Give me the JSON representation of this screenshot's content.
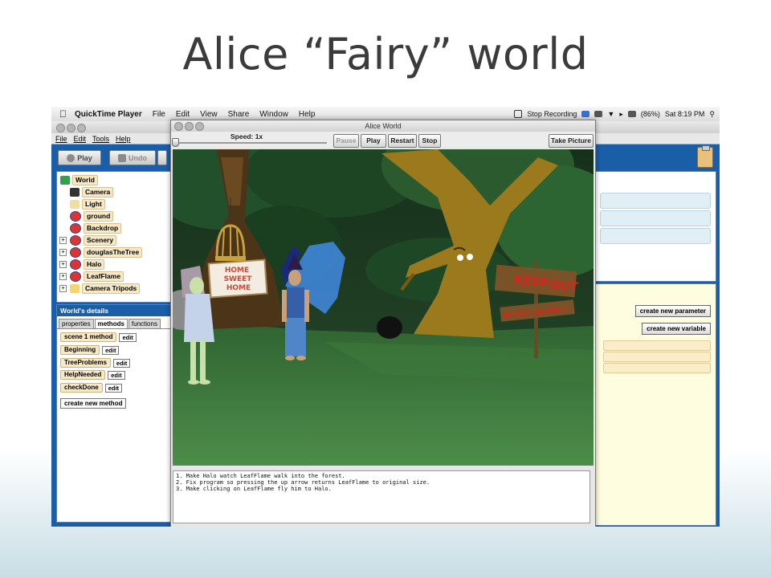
{
  "slide": {
    "title": "Alice “Fairy” world"
  },
  "mac_menubar": {
    "app_name": "QuickTime Player",
    "items": [
      "File",
      "Edit",
      "View",
      "Share",
      "Window",
      "Help"
    ],
    "right": {
      "recording": "Stop Recording",
      "battery": "(86%)",
      "clock": "Sat 8:19 PM"
    }
  },
  "ide": {
    "menu": [
      "File",
      "Edit",
      "Tools",
      "Help"
    ],
    "toolbar": {
      "play": "Play",
      "undo": "Undo"
    },
    "object_tree": [
      {
        "label": "World",
        "icon": "world-icon",
        "expandable": false
      },
      {
        "label": "Camera",
        "icon": "camera-icon",
        "expandable": false
      },
      {
        "label": "Light",
        "icon": "light-icon",
        "expandable": false
      },
      {
        "label": "ground",
        "icon": "object-icon",
        "expandable": false
      },
      {
        "label": "Backdrop",
        "icon": "object-icon",
        "expandable": false
      },
      {
        "label": "Scenery",
        "icon": "object-icon",
        "expandable": true
      },
      {
        "label": "douglasTheTree",
        "icon": "object-icon",
        "expandable": true
      },
      {
        "label": "Halo",
        "icon": "object-icon",
        "expandable": true
      },
      {
        "label": "LeafFlame",
        "icon": "object-icon",
        "expandable": true
      },
      {
        "label": "Camera Tripods",
        "icon": "folder-icon",
        "expandable": true
      }
    ],
    "details": {
      "header": "World's details",
      "tabs": [
        "properties",
        "methods",
        "functions"
      ],
      "active_tab": "methods",
      "methods": [
        "scene 1 method",
        "Beginning",
        "TreeProblems",
        "HelpNeeded",
        "checkDone"
      ],
      "edit_label": "edit",
      "create_method": "create new method"
    },
    "right_panel": {
      "create_parameter": "create new parameter",
      "create_variable": "create new variable"
    }
  },
  "world_window": {
    "title": "Alice World",
    "speed_label": "Speed: 1x",
    "speed_value": 1,
    "buttons": {
      "pause": "Pause",
      "play": "Play",
      "restart": "Restart",
      "stop": "Stop",
      "take_picture": "Take Picture"
    },
    "scene_text": {
      "sign_home": [
        "HOME",
        "SWEET",
        "HOME"
      ],
      "sign_keep": "KEEP",
      "sign_out": "OUT",
      "sign_scribble": "NO BUGS ALLOWED"
    },
    "instructions": [
      "1. Make Halo watch LeafFlame walk into the forest.",
      "2. Fix program so pressing the up arrow returns LeafFlame to original size.",
      "3. Make clicking on LeafFlame fly him to Halo."
    ]
  },
  "colors": {
    "ide_blue": "#1b5ea8",
    "ground_green": "#3f7a3e",
    "sign_red": "#e0201c"
  }
}
